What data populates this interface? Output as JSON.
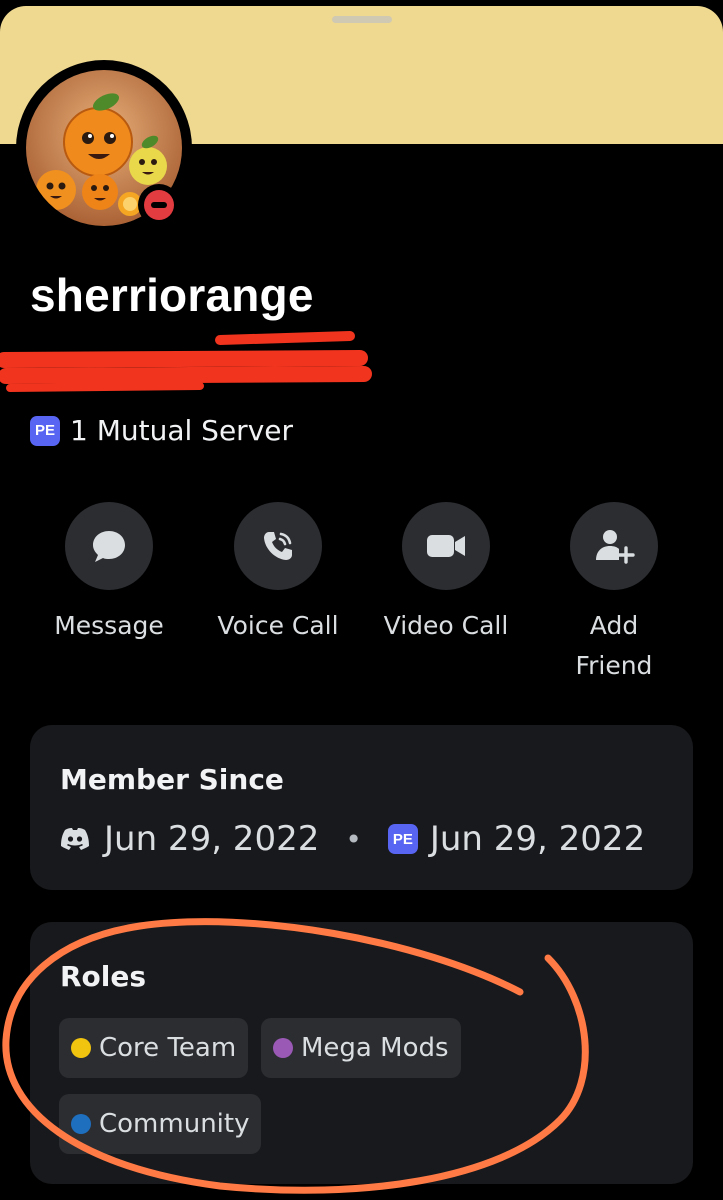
{
  "profile": {
    "username": "sherriorange",
    "mutual_badge": "PE",
    "mutual_text": "1 Mutual Server"
  },
  "actions": [
    {
      "label": "Message",
      "icon": "message-bubble-icon"
    },
    {
      "label": "Voice Call",
      "icon": "phone-icon"
    },
    {
      "label": "Video Call",
      "icon": "video-camera-icon"
    },
    {
      "label": "Add Friend",
      "icon": "add-friend-icon"
    }
  ],
  "member_since": {
    "title": "Member Since",
    "discord_date": "Jun 29, 2022",
    "separator": "•",
    "server_badge": "PE",
    "server_date": "Jun 29, 2022"
  },
  "roles": {
    "title": "Roles",
    "items": [
      {
        "label": "Core Team",
        "color": "#f1c40f"
      },
      {
        "label": "Mega Mods",
        "color": "#9b59b6"
      },
      {
        "label": "Community",
        "color": "#1f6fbf"
      }
    ]
  },
  "colors": {
    "banner": "#efd88f",
    "status_dnd": "#e23b40",
    "blurple": "#5865f2",
    "annotation": "#ff7a45",
    "redaction": "#f0341e"
  }
}
